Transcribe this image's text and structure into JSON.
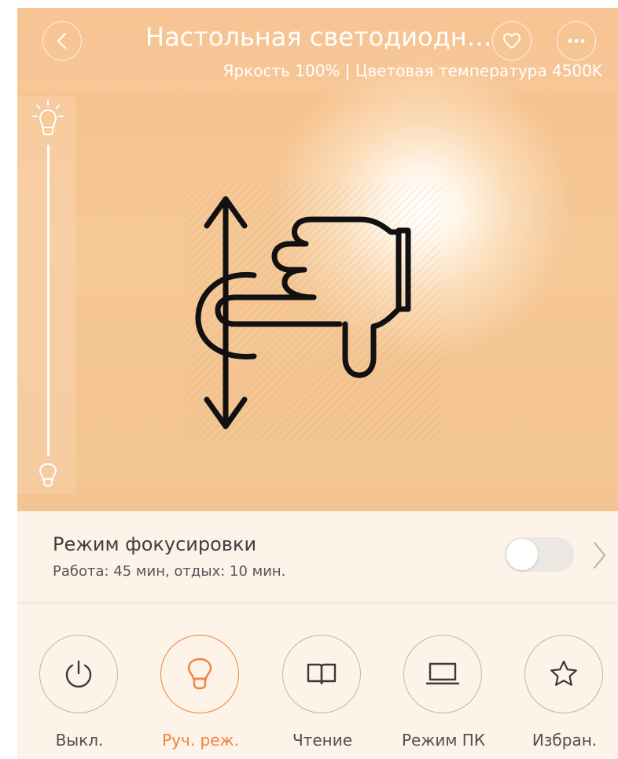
{
  "header": {
    "title": "Настольная светодиодна...",
    "subtitle": "Яркость 100% | Цветовая температура 4500K",
    "back_icon": "chevron-left-icon",
    "favorite_icon": "heart-icon",
    "more_icon": "ellipsis-icon"
  },
  "brightness": {
    "level_percent": 100,
    "top_icon": "bright-bulb-icon",
    "bottom_icon": "dim-bulb-icon"
  },
  "gesture": {
    "icon": "hand-swipe-vertical-icon"
  },
  "focus_mode": {
    "title": "Режим фокусировки",
    "subtitle": "Работа: 45 мин, отдых: 10 мин.",
    "enabled": false
  },
  "modes": [
    {
      "label": "Выкл.",
      "icon": "power-icon",
      "active": false
    },
    {
      "label": "Руч. реж.",
      "icon": "bulb-icon",
      "active": true
    },
    {
      "label": "Чтение",
      "icon": "book-icon",
      "active": false
    },
    {
      "label": "Режим ПК",
      "icon": "laptop-icon",
      "active": false
    },
    {
      "label": "Избран.",
      "icon": "star-icon",
      "active": false
    }
  ],
  "colors": {
    "accent": "#f2823c",
    "hero_background": "#f6c28d",
    "panel_background": "#fdf3e8"
  }
}
